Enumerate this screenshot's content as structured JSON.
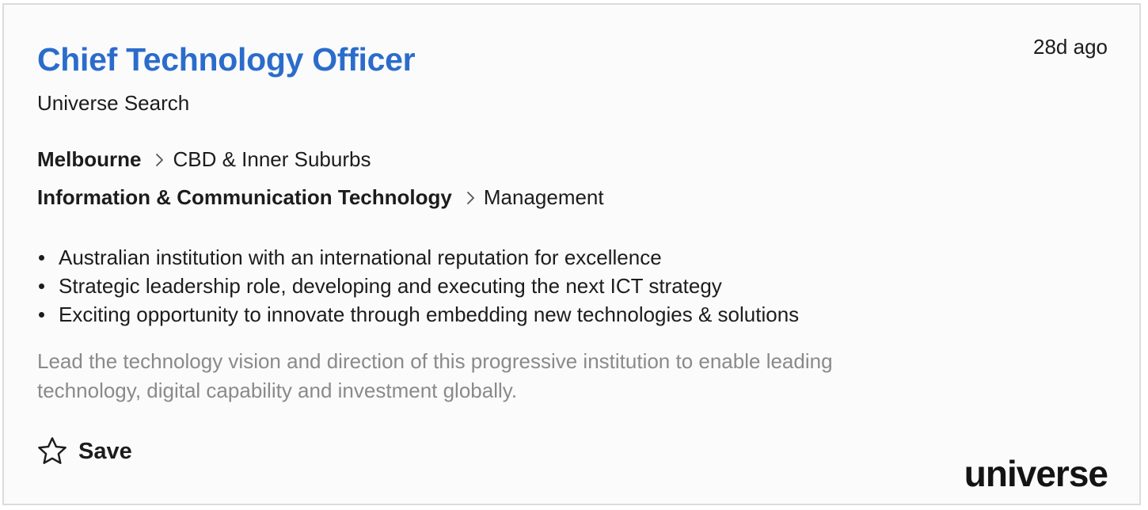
{
  "job": {
    "title": "Chief Technology Officer",
    "company": "Universe Search",
    "posted": "28d ago",
    "location": {
      "primary": "Melbourne",
      "secondary": "CBD & Inner Suburbs"
    },
    "classification": {
      "primary": "Information & Communication Technology",
      "secondary": "Management"
    },
    "bullets": [
      "Australian institution with an international reputation for excellence",
      "Strategic leadership role, developing and executing the next ICT strategy",
      "Exciting opportunity to innovate through embedding new technologies & solutions"
    ],
    "teaser": "Lead the technology vision and direction of this progressive institution to enable leading technology, digital capability and investment globally.",
    "save_label": "Save",
    "logo_text": "universe"
  },
  "icons": {
    "chevron": "chevron-right-icon",
    "save": "star-outline-icon"
  },
  "colors": {
    "title": "#2b6ccb",
    "text": "#1c1c1c",
    "muted": "#8a8a8a",
    "card_bg": "#fbfbfc",
    "border": "#dcdcdc"
  }
}
